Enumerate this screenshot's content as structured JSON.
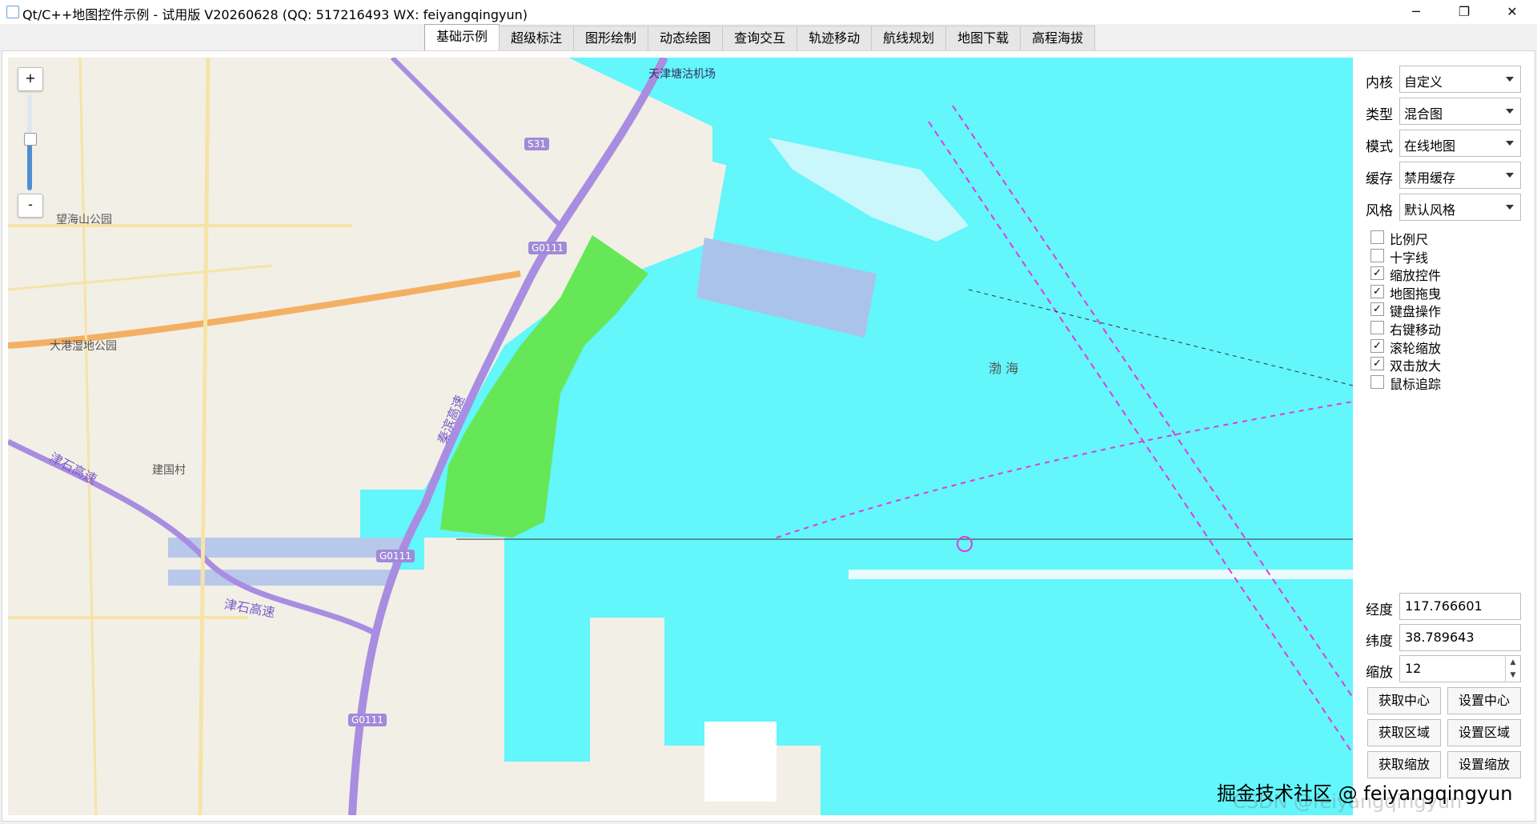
{
  "window": {
    "title": "Qt/C++地图控件示例 - 试用版 V20260628 (QQ: 517216493 WX: feiyangqingyun)",
    "minimize_glyph": "─",
    "maximize_glyph": "❐",
    "close_glyph": "✕"
  },
  "tabs": [
    "基础示例",
    "超级标注",
    "图形绘制",
    "动态绘图",
    "查询交互",
    "轨迹移动",
    "航线规划",
    "地图下载",
    "高程海拔"
  ],
  "active_tab": "基础示例",
  "map": {
    "zoom_in_label": "+",
    "zoom_out_label": "-",
    "labels": {
      "airport": "天津塘沽机场",
      "park1": "望海山公园",
      "park2": "大港湿地公园",
      "village": "建国村",
      "highway1": "津石高速",
      "highway2": "津石高速",
      "coastal": "秦滨高速",
      "sea": "渤 海"
    },
    "shields": [
      "S31",
      "G0111",
      "G0111",
      "G0111"
    ]
  },
  "side": {
    "combos": [
      {
        "label": "内核",
        "value": "自定义"
      },
      {
        "label": "类型",
        "value": "混合图"
      },
      {
        "label": "模式",
        "value": "在线地图"
      },
      {
        "label": "缓存",
        "value": "禁用缓存"
      },
      {
        "label": "风格",
        "value": "默认风格"
      }
    ],
    "checkboxes": [
      {
        "label": "比例尺",
        "checked": false,
        "mark": ""
      },
      {
        "label": "十字线",
        "checked": false,
        "mark": ""
      },
      {
        "label": "缩放控件",
        "checked": true,
        "mark": "✓"
      },
      {
        "label": "地图拖曳",
        "checked": true,
        "mark": "✓"
      },
      {
        "label": "键盘操作",
        "checked": true,
        "mark": "✓"
      },
      {
        "label": "右键移动",
        "checked": false,
        "mark": ""
      },
      {
        "label": "滚轮缩放",
        "checked": true,
        "mark": "✓"
      },
      {
        "label": "双击放大",
        "checked": true,
        "mark": "✓"
      },
      {
        "label": "鼠标追踪",
        "checked": false,
        "mark": ""
      }
    ],
    "longitude": {
      "label": "经度",
      "value": "117.766601"
    },
    "latitude": {
      "label": "纬度",
      "value": "38.789643"
    },
    "zoom": {
      "label": "缩放",
      "value": "12"
    },
    "buttons": [
      "获取中心",
      "设置中心",
      "获取区域",
      "设置区域",
      "获取缩放",
      "设置缩放"
    ]
  },
  "watermark": "掘金技术社区 @ feiyangqingyun",
  "watermark_faint": "CSDN @feiyangqingyun"
}
